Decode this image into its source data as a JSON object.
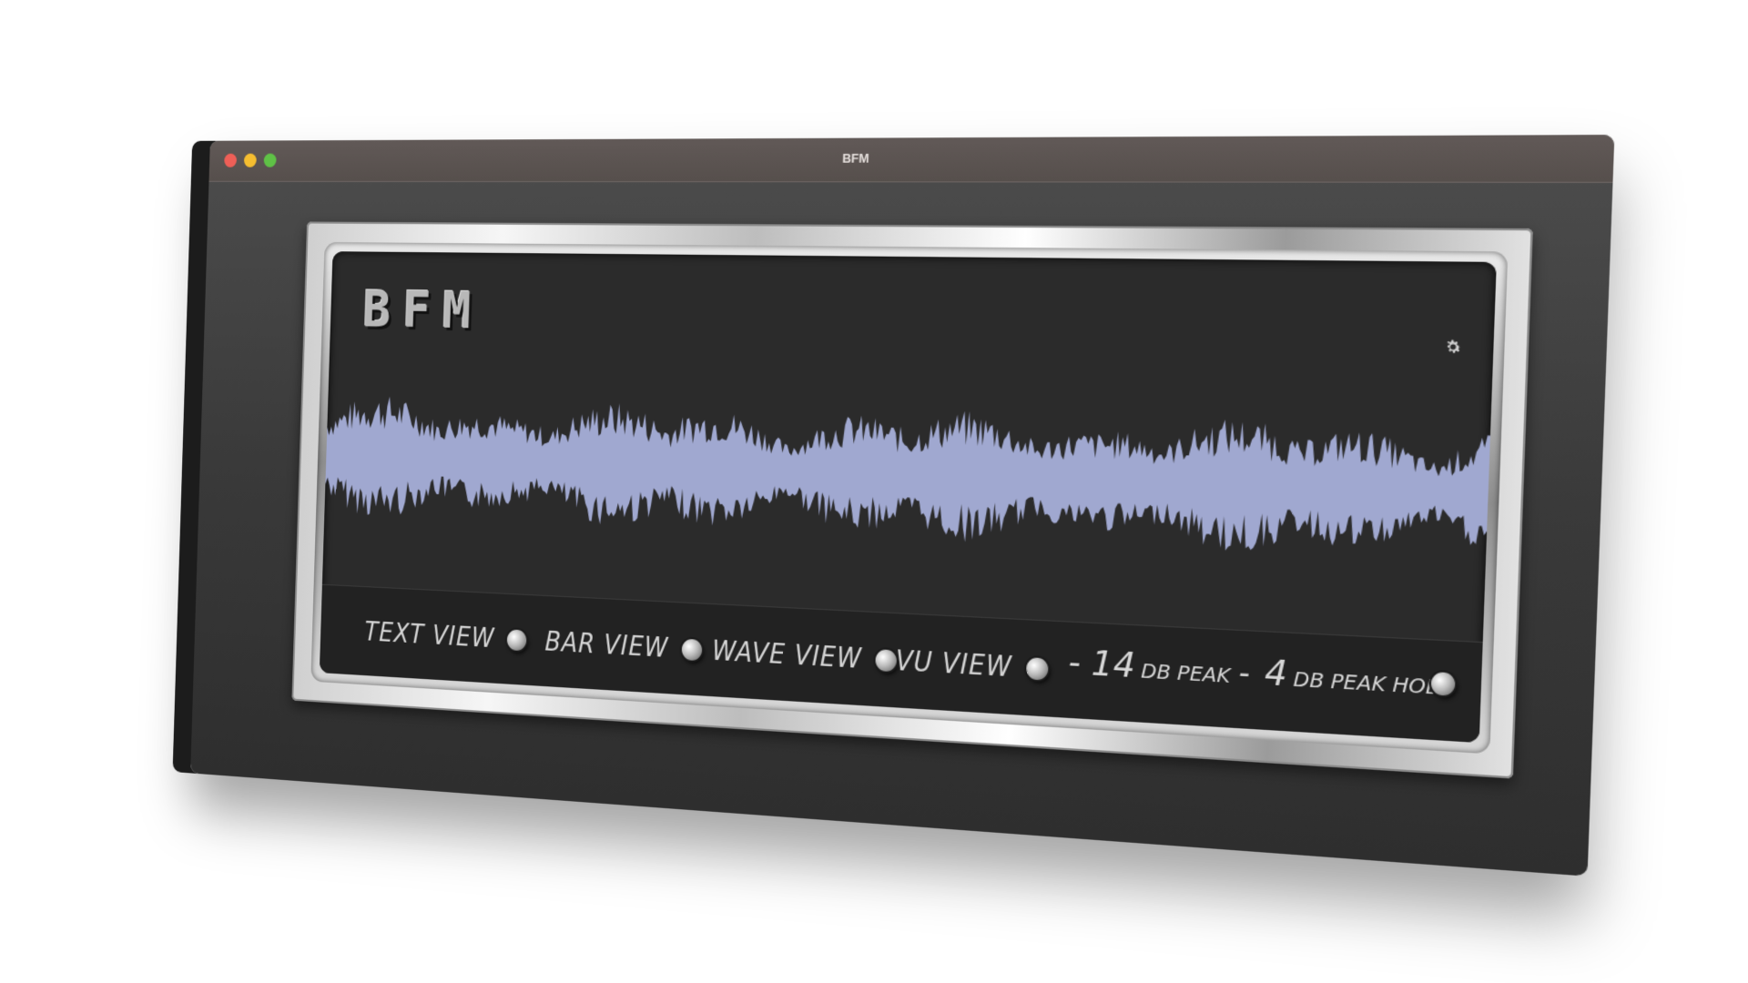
{
  "window": {
    "title": "BFM",
    "controls": [
      "close",
      "minimize",
      "maximize"
    ]
  },
  "display": {
    "logo": "BFM",
    "settings_icon": "gear-icon",
    "waveform_color": "#a0a8d0",
    "background_color": "#2b2b2b"
  },
  "view_buttons": [
    {
      "label": "TEXT VIEW"
    },
    {
      "label": "BAR VIEW"
    },
    {
      "label": "WAVE VIEW"
    },
    {
      "label": "VU VIEW"
    }
  ],
  "readout": {
    "peak_value": "- 14",
    "peak_unit": "DB PEAK",
    "separator": "-",
    "hold_value": "4",
    "hold_unit": "DB PEAK HOLD"
  }
}
